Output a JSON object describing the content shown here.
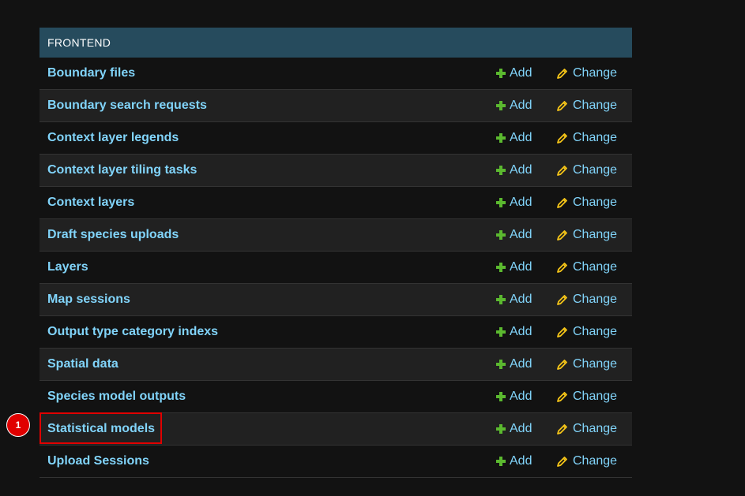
{
  "module": {
    "caption": "FRONTEND",
    "add_label": "Add",
    "change_label": "Change",
    "rows": [
      {
        "name": "Boundary files"
      },
      {
        "name": "Boundary search requests"
      },
      {
        "name": "Context layer legends"
      },
      {
        "name": "Context layer tiling tasks"
      },
      {
        "name": "Context layers"
      },
      {
        "name": "Draft species uploads"
      },
      {
        "name": "Layers"
      },
      {
        "name": "Map sessions"
      },
      {
        "name": "Output type category indexs"
      },
      {
        "name": "Spatial data"
      },
      {
        "name": "Species model outputs"
      },
      {
        "name": "Statistical models"
      },
      {
        "name": "Upload Sessions"
      }
    ]
  },
  "annotation": {
    "badge_label": "1",
    "highlight_color": "#e00000"
  },
  "colors": {
    "caption_bg": "#264b5d",
    "link": "#81d4fa",
    "add_icon": "#5bb92f",
    "change_icon": "#f5c518"
  }
}
